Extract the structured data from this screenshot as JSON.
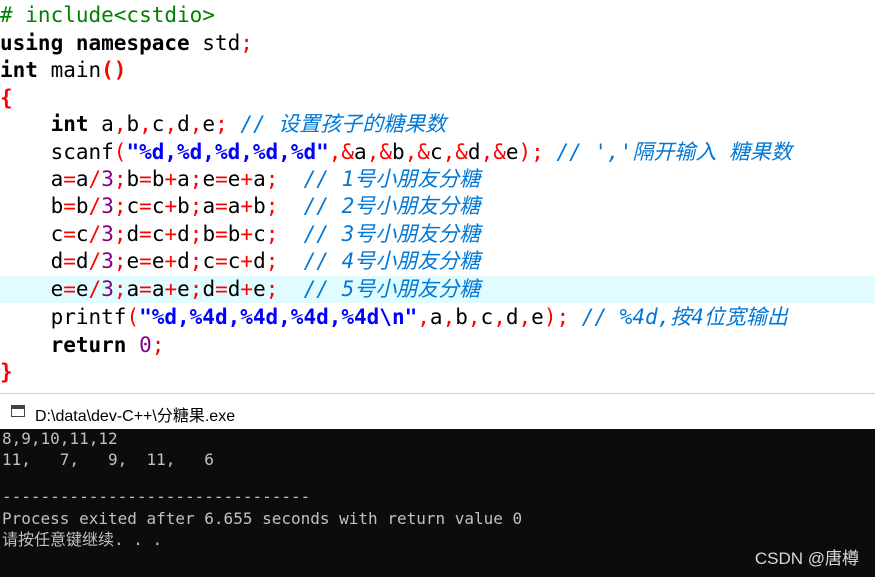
{
  "editor": {
    "lines": [
      {
        "tokens": [
          {
            "t": "# include<cstdio>",
            "c": "pp"
          }
        ]
      },
      {
        "tokens": [
          {
            "t": "using namespace",
            "c": "kw"
          },
          {
            "t": " std",
            "c": "id"
          },
          {
            "t": ";",
            "c": "op"
          }
        ]
      },
      {
        "tokens": [
          {
            "t": "int",
            "c": "kw"
          },
          {
            "t": " main",
            "c": "id"
          },
          {
            "t": "()",
            "c": "br"
          }
        ]
      },
      {
        "tokens": [
          {
            "t": "{",
            "c": "br"
          }
        ]
      },
      {
        "tokens": [
          {
            "t": "    ",
            "c": "id"
          },
          {
            "t": "int",
            "c": "kw"
          },
          {
            "t": " a",
            "c": "id"
          },
          {
            "t": ",",
            "c": "op"
          },
          {
            "t": "b",
            "c": "id"
          },
          {
            "t": ",",
            "c": "op"
          },
          {
            "t": "c",
            "c": "id"
          },
          {
            "t": ",",
            "c": "op"
          },
          {
            "t": "d",
            "c": "id"
          },
          {
            "t": ",",
            "c": "op"
          },
          {
            "t": "e",
            "c": "id"
          },
          {
            "t": ";",
            "c": "op"
          },
          {
            "t": " // 设置孩子的糖果数",
            "c": "cm"
          }
        ]
      },
      {
        "tokens": [
          {
            "t": "    scanf",
            "c": "id"
          },
          {
            "t": "(",
            "c": "op"
          },
          {
            "t": "\"%d,%d,%d,%d,%d\"",
            "c": "str"
          },
          {
            "t": ",&",
            "c": "op"
          },
          {
            "t": "a",
            "c": "id"
          },
          {
            "t": ",&",
            "c": "op"
          },
          {
            "t": "b",
            "c": "id"
          },
          {
            "t": ",&",
            "c": "op"
          },
          {
            "t": "c",
            "c": "id"
          },
          {
            "t": ",&",
            "c": "op"
          },
          {
            "t": "d",
            "c": "id"
          },
          {
            "t": ",&",
            "c": "op"
          },
          {
            "t": "e",
            "c": "id"
          },
          {
            "t": ");",
            "c": "op"
          },
          {
            "t": " // ','隔开输入 糖果数",
            "c": "cm"
          }
        ]
      },
      {
        "tokens": [
          {
            "t": "    a",
            "c": "id"
          },
          {
            "t": "=",
            "c": "op"
          },
          {
            "t": "a",
            "c": "id"
          },
          {
            "t": "/",
            "c": "op"
          },
          {
            "t": "3",
            "c": "num"
          },
          {
            "t": ";",
            "c": "op"
          },
          {
            "t": "b",
            "c": "id"
          },
          {
            "t": "=",
            "c": "op"
          },
          {
            "t": "b",
            "c": "id"
          },
          {
            "t": "+",
            "c": "op"
          },
          {
            "t": "a",
            "c": "id"
          },
          {
            "t": ";",
            "c": "op"
          },
          {
            "t": "e",
            "c": "id"
          },
          {
            "t": "=",
            "c": "op"
          },
          {
            "t": "e",
            "c": "id"
          },
          {
            "t": "+",
            "c": "op"
          },
          {
            "t": "a",
            "c": "id"
          },
          {
            "t": ";",
            "c": "op"
          },
          {
            "t": "  // 1号小朋友分糖",
            "c": "cm"
          }
        ]
      },
      {
        "tokens": [
          {
            "t": "    b",
            "c": "id"
          },
          {
            "t": "=",
            "c": "op"
          },
          {
            "t": "b",
            "c": "id"
          },
          {
            "t": "/",
            "c": "op"
          },
          {
            "t": "3",
            "c": "num"
          },
          {
            "t": ";",
            "c": "op"
          },
          {
            "t": "c",
            "c": "id"
          },
          {
            "t": "=",
            "c": "op"
          },
          {
            "t": "c",
            "c": "id"
          },
          {
            "t": "+",
            "c": "op"
          },
          {
            "t": "b",
            "c": "id"
          },
          {
            "t": ";",
            "c": "op"
          },
          {
            "t": "a",
            "c": "id"
          },
          {
            "t": "=",
            "c": "op"
          },
          {
            "t": "a",
            "c": "id"
          },
          {
            "t": "+",
            "c": "op"
          },
          {
            "t": "b",
            "c": "id"
          },
          {
            "t": ";",
            "c": "op"
          },
          {
            "t": "  // 2号小朋友分糖",
            "c": "cm"
          }
        ]
      },
      {
        "tokens": [
          {
            "t": "    c",
            "c": "id"
          },
          {
            "t": "=",
            "c": "op"
          },
          {
            "t": "c",
            "c": "id"
          },
          {
            "t": "/",
            "c": "op"
          },
          {
            "t": "3",
            "c": "num"
          },
          {
            "t": ";",
            "c": "op"
          },
          {
            "t": "d",
            "c": "id"
          },
          {
            "t": "=",
            "c": "op"
          },
          {
            "t": "c",
            "c": "id"
          },
          {
            "t": "+",
            "c": "op"
          },
          {
            "t": "d",
            "c": "id"
          },
          {
            "t": ";",
            "c": "op"
          },
          {
            "t": "b",
            "c": "id"
          },
          {
            "t": "=",
            "c": "op"
          },
          {
            "t": "b",
            "c": "id"
          },
          {
            "t": "+",
            "c": "op"
          },
          {
            "t": "c",
            "c": "id"
          },
          {
            "t": ";",
            "c": "op"
          },
          {
            "t": "  // 3号小朋友分糖",
            "c": "cm"
          }
        ]
      },
      {
        "tokens": [
          {
            "t": "    d",
            "c": "id"
          },
          {
            "t": "=",
            "c": "op"
          },
          {
            "t": "d",
            "c": "id"
          },
          {
            "t": "/",
            "c": "op"
          },
          {
            "t": "3",
            "c": "num"
          },
          {
            "t": ";",
            "c": "op"
          },
          {
            "t": "e",
            "c": "id"
          },
          {
            "t": "=",
            "c": "op"
          },
          {
            "t": "e",
            "c": "id"
          },
          {
            "t": "+",
            "c": "op"
          },
          {
            "t": "d",
            "c": "id"
          },
          {
            "t": ";",
            "c": "op"
          },
          {
            "t": "c",
            "c": "id"
          },
          {
            "t": "=",
            "c": "op"
          },
          {
            "t": "c",
            "c": "id"
          },
          {
            "t": "+",
            "c": "op"
          },
          {
            "t": "d",
            "c": "id"
          },
          {
            "t": ";",
            "c": "op"
          },
          {
            "t": "  // 4号小朋友分糖",
            "c": "cm"
          }
        ]
      },
      {
        "current": true,
        "tokens": [
          {
            "t": "    e",
            "c": "id"
          },
          {
            "t": "=",
            "c": "op"
          },
          {
            "t": "e",
            "c": "id"
          },
          {
            "t": "/",
            "c": "op"
          },
          {
            "t": "3",
            "c": "num"
          },
          {
            "t": ";",
            "c": "op"
          },
          {
            "t": "a",
            "c": "id"
          },
          {
            "t": "=",
            "c": "op"
          },
          {
            "t": "a",
            "c": "id"
          },
          {
            "t": "+",
            "c": "op"
          },
          {
            "t": "e",
            "c": "id"
          },
          {
            "t": ";",
            "c": "op"
          },
          {
            "t": "d",
            "c": "id"
          },
          {
            "t": "=",
            "c": "op"
          },
          {
            "t": "d",
            "c": "id"
          },
          {
            "t": "+",
            "c": "op"
          },
          {
            "t": "e",
            "c": "id"
          },
          {
            "t": ";",
            "c": "op"
          },
          {
            "t": "  // 5号小朋友分糖",
            "c": "cm"
          }
        ]
      },
      {
        "tokens": [
          {
            "t": "    printf",
            "c": "id"
          },
          {
            "t": "(",
            "c": "op"
          },
          {
            "t": "\"%d,%4d,%4d,%4d,%4d\\n\"",
            "c": "str"
          },
          {
            "t": ",",
            "c": "op"
          },
          {
            "t": "a",
            "c": "id"
          },
          {
            "t": ",",
            "c": "op"
          },
          {
            "t": "b",
            "c": "id"
          },
          {
            "t": ",",
            "c": "op"
          },
          {
            "t": "c",
            "c": "id"
          },
          {
            "t": ",",
            "c": "op"
          },
          {
            "t": "d",
            "c": "id"
          },
          {
            "t": ",",
            "c": "op"
          },
          {
            "t": "e",
            "c": "id"
          },
          {
            "t": ");",
            "c": "op"
          },
          {
            "t": " // %4d,按4位宽输出",
            "c": "cm"
          }
        ]
      },
      {
        "tokens": [
          {
            "t": "    ",
            "c": "id"
          },
          {
            "t": "return",
            "c": "kw"
          },
          {
            "t": " ",
            "c": "id"
          },
          {
            "t": "0",
            "c": "num"
          },
          {
            "t": ";",
            "c": "op"
          }
        ]
      },
      {
        "tokens": [
          {
            "t": "}",
            "c": "br"
          }
        ]
      }
    ]
  },
  "console": {
    "title": "D:\\data\\dev-C++\\分糖果.exe",
    "lines": [
      "8,9,10,11,12",
      "11,   7,   9,  11,   6",
      "",
      "--------------------------------",
      "Process exited after 6.655 seconds with return value 0",
      "请按任意键继续. . ."
    ]
  },
  "watermark": "CSDN @唐樽"
}
